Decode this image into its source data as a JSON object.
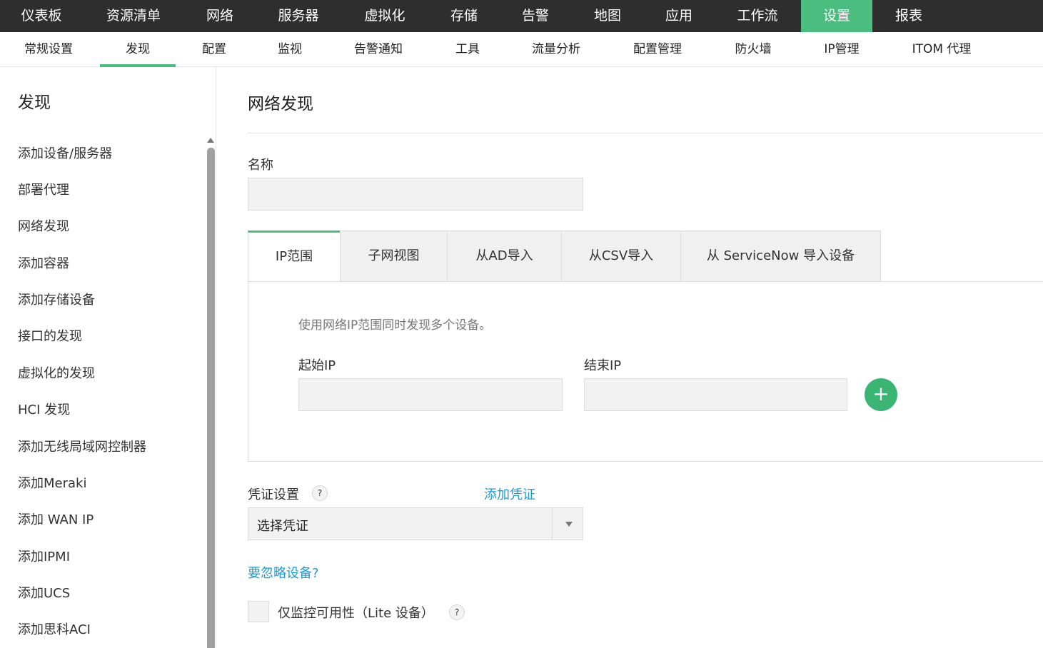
{
  "topnav": {
    "items": [
      "仪表板",
      "资源清单",
      "网络",
      "服务器",
      "虚拟化",
      "存储",
      "告警",
      "地图",
      "应用",
      "工作流",
      "设置",
      "报表"
    ],
    "active": "设置",
    "accent_color": "#4bbd7e"
  },
  "subnav": {
    "items": [
      "常规设置",
      "发现",
      "配置",
      "监视",
      "告警通知",
      "工具",
      "流量分析",
      "配置管理",
      "防火墙",
      "IP管理",
      "ITOM 代理"
    ],
    "active": "发现"
  },
  "sidebar": {
    "title": "发现",
    "items": [
      "添加设备/服务器",
      "部署代理",
      "网络发现",
      "添加容器",
      "添加存储设备",
      "接口的发现",
      "虚拟化的发现",
      "HCI 发现",
      "添加无线局域网控制器",
      "添加Meraki",
      "添加 WAN IP",
      "添加IPMI",
      "添加UCS",
      "添加思科ACI"
    ]
  },
  "main": {
    "title": "网络发现",
    "name_label": "名称",
    "name_value": "",
    "tabs": [
      "IP范围",
      "子网视图",
      "从AD导入",
      "从CSV导入",
      "从 ServiceNow 导入设备"
    ],
    "active_tab": "IP范围",
    "hint": "使用网络IP范围同时发现多个设备。",
    "start_ip_label": "起始IP",
    "end_ip_label": "结束IP",
    "start_ip_value": "",
    "end_ip_value": "",
    "add_button": "+",
    "credential_label": "凭证设置",
    "help_glyph": "?",
    "add_credential_link": "添加凭证",
    "credential_select_value": "选择凭证",
    "ignore_devices_link": "要忽略设备?",
    "lite_checkbox_label": "仅监控可用性（Lite 设备）"
  }
}
